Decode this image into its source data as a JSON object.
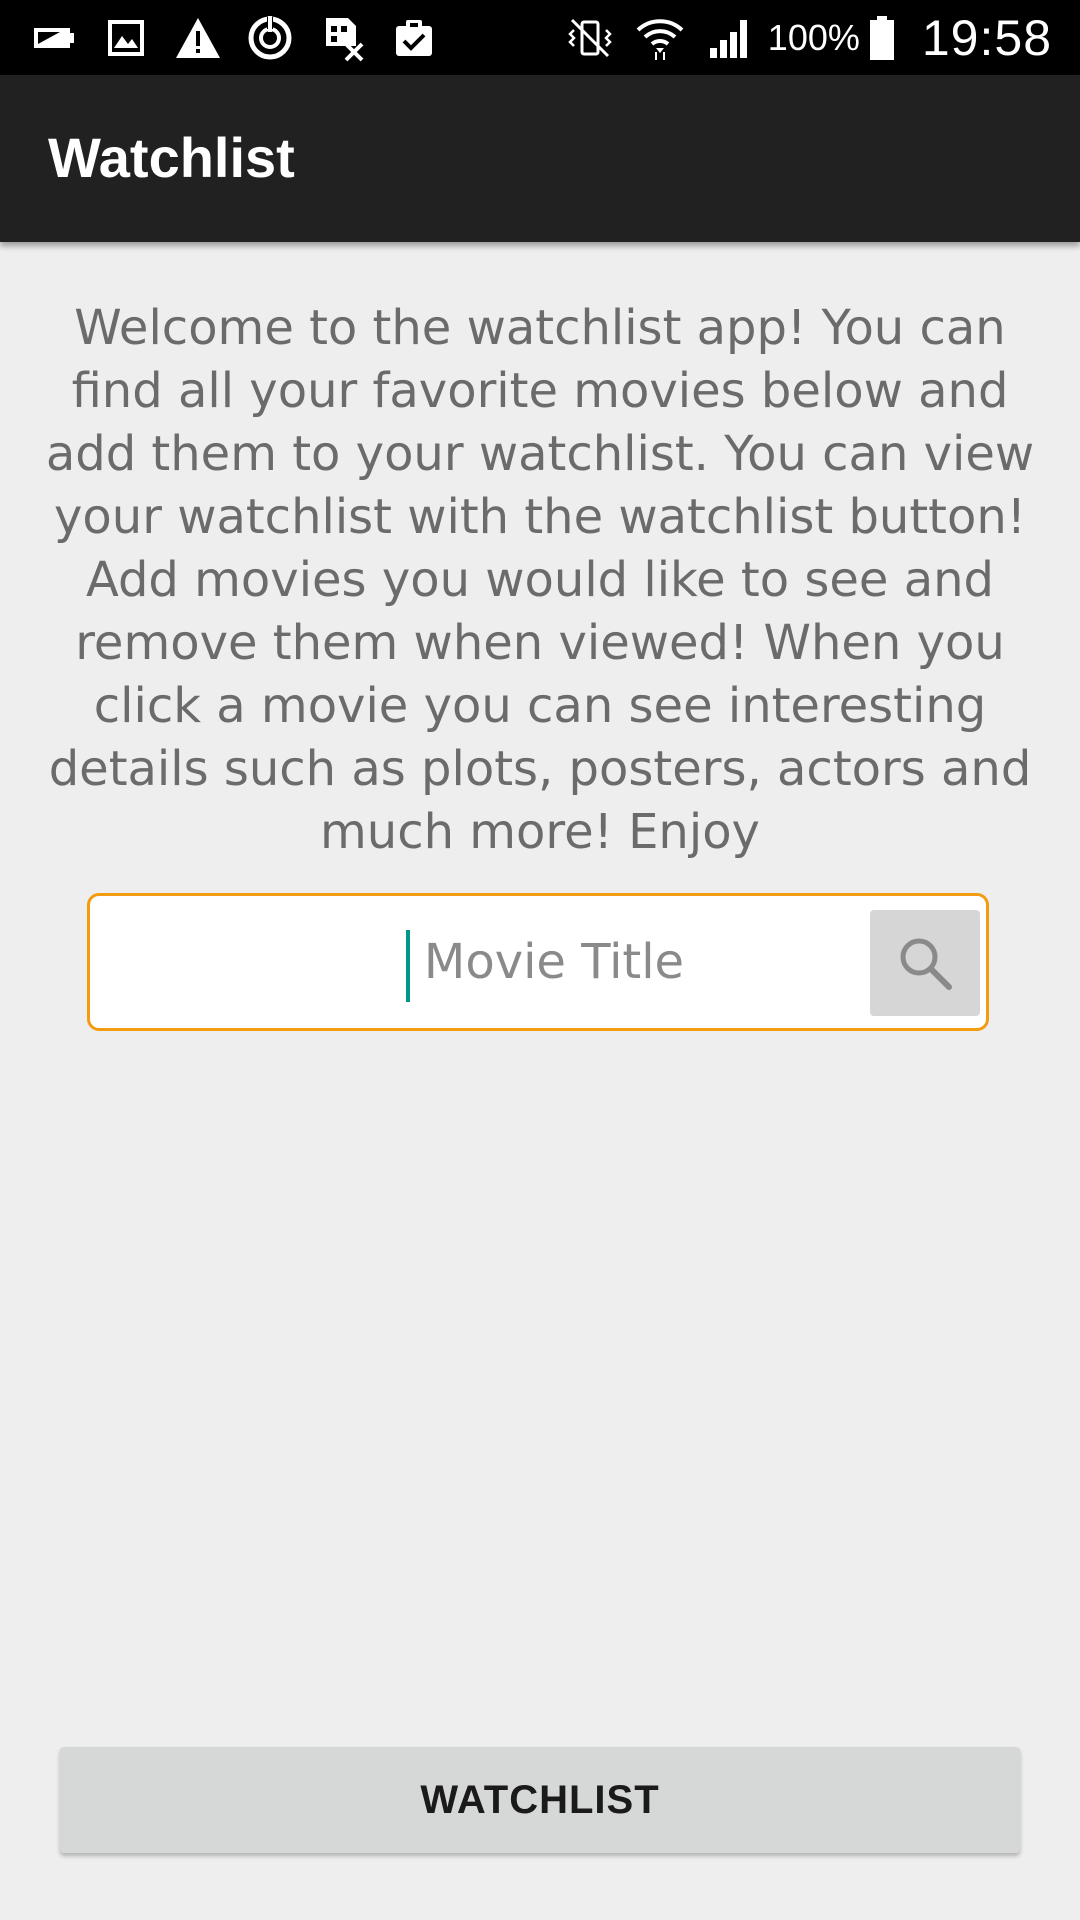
{
  "status_bar": {
    "left_icons": [
      "battery-saver-icon",
      "image-icon",
      "warning-icon",
      "sync-icon",
      "sim-card-off-icon",
      "clipboard-check-icon"
    ],
    "right_icons": [
      "vibrate-mute-icon",
      "wifi-icon",
      "cellular-signal-icon"
    ],
    "battery_percent": "100%",
    "time": "19:58"
  },
  "app_bar": {
    "title": "Watchlist"
  },
  "main": {
    "welcome_text": "Welcome to the watchlist app! You can find all your favorite movies below and add them to your watchlist. You can view your watchlist with the watchlist button! Add movies you would like to see and remove them when viewed! When you click a movie you can see interesting details such as plots, posters, actors and much more! Enjoy",
    "search": {
      "placeholder": "Movie Title",
      "value": "",
      "button_icon": "search-icon"
    }
  },
  "footer": {
    "watchlist_button_label": "WATCHLIST"
  },
  "colors": {
    "status_bar_bg": "#000000",
    "app_bar_bg": "#212121",
    "page_bg": "#eeeeee",
    "search_border": "#f39c12",
    "cursor": "#009688",
    "button_bg": "#d6d7d7"
  }
}
